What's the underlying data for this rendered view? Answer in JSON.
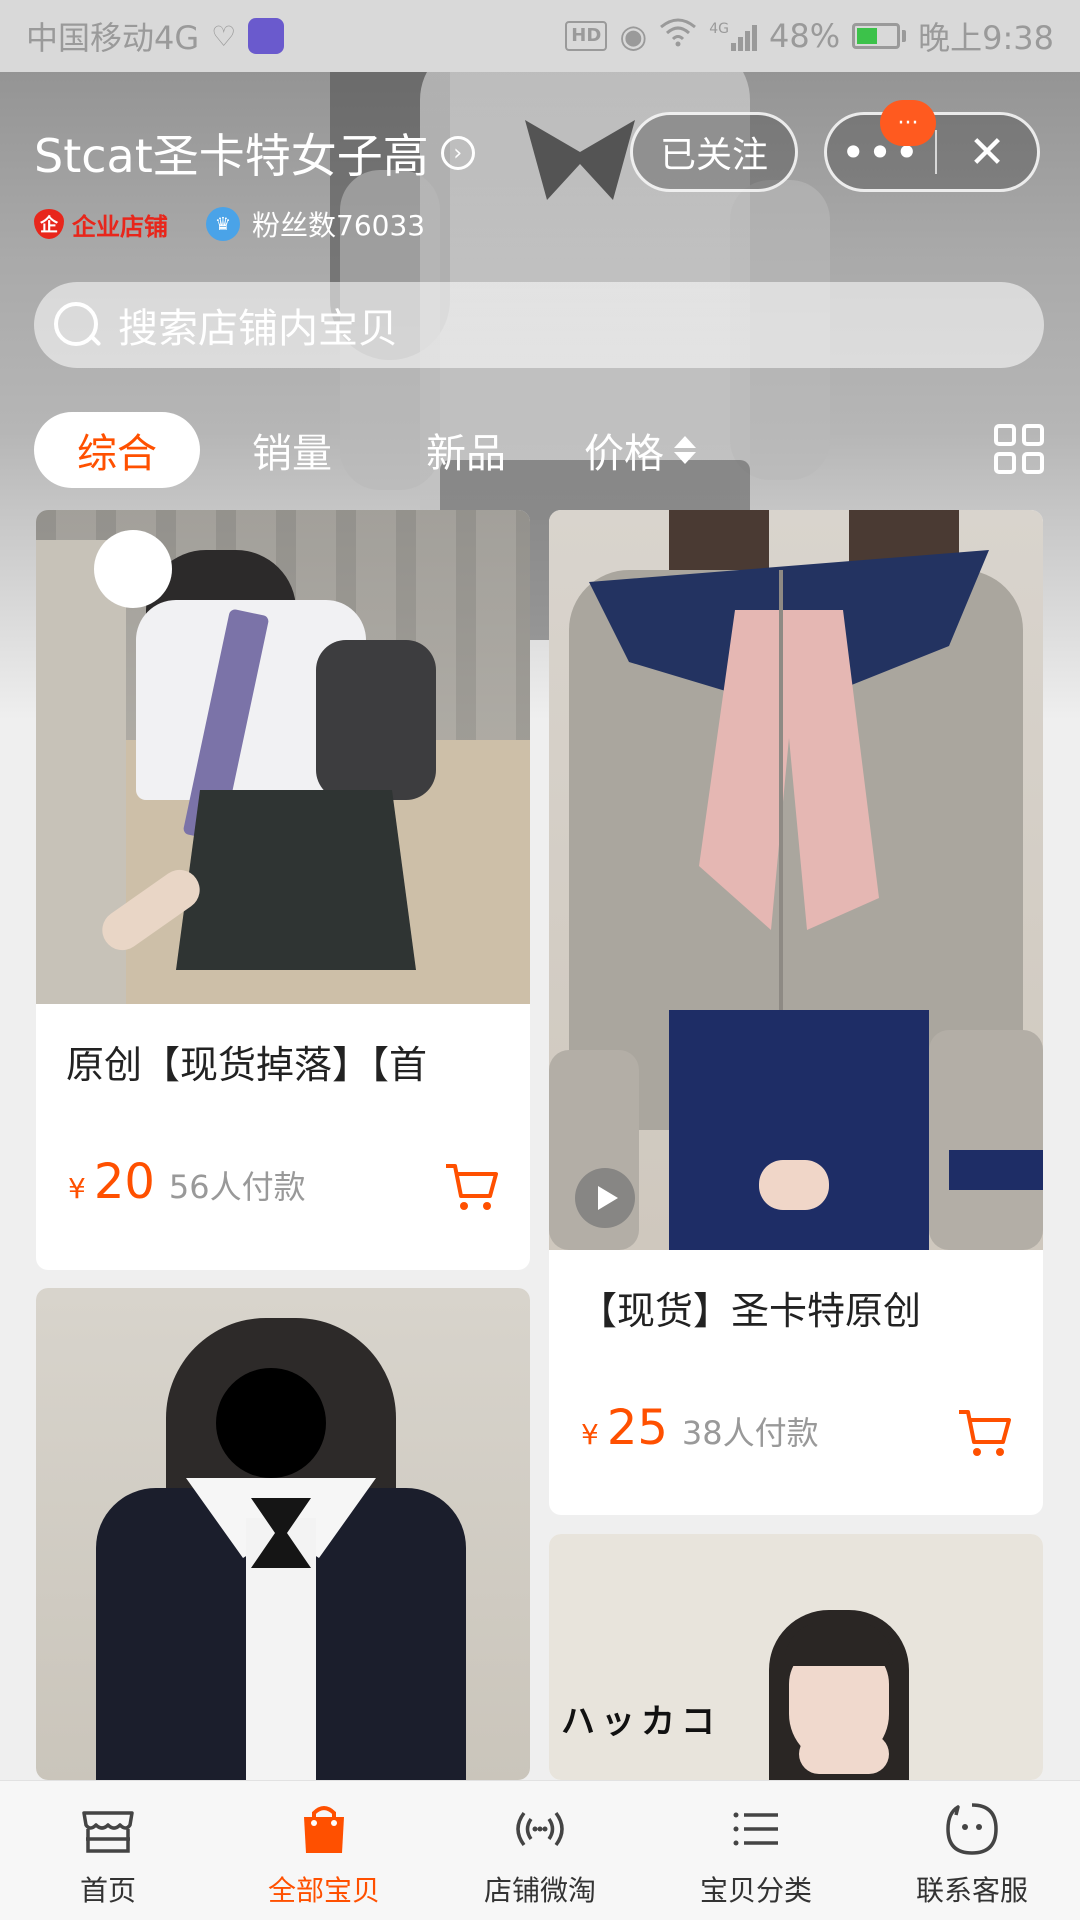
{
  "status_bar": {
    "carrier": "中国移动4G",
    "hd": "HD",
    "signal": "4G",
    "battery": "48%",
    "time": "晚上9:38"
  },
  "shop": {
    "name": "Stcat圣卡特女子高",
    "follow_label": "已关注",
    "message_badge": "···",
    "enterprise_label": "企业店铺",
    "fans_label": "粉丝数76033"
  },
  "search": {
    "placeholder": "搜索店铺内宝贝"
  },
  "sort_tabs": [
    {
      "label": "综合",
      "active": true
    },
    {
      "label": "销量",
      "active": false
    },
    {
      "label": "新品",
      "active": false
    },
    {
      "label": "价格",
      "active": false
    }
  ],
  "products": [
    {
      "title": "原创【现货掉落】【首",
      "currency": "¥",
      "price": "20",
      "sold": "56人付款"
    },
    {
      "title": "【现货】圣卡特原创",
      "currency": "¥",
      "price": "25",
      "sold": "38人付款",
      "has_video": true
    },
    {
      "title": "",
      "currency": "",
      "price": "",
      "sold": ""
    },
    {
      "title": "",
      "currency": "",
      "price": "",
      "sold": "",
      "image_text": "ハッカコ"
    }
  ],
  "tab_bar": [
    {
      "label": "首页",
      "icon": "store-icon",
      "active": false
    },
    {
      "label": "全部宝贝",
      "icon": "bag-icon",
      "active": true
    },
    {
      "label": "店铺微淘",
      "icon": "broadcast-icon",
      "active": false
    },
    {
      "label": "宝贝分类",
      "icon": "list-icon",
      "active": false
    },
    {
      "label": "联系客服",
      "icon": "chat-face-icon",
      "active": false
    }
  ],
  "colors": {
    "accent": "#ff5000",
    "enterprise_red": "#e8261b",
    "text_muted": "#999999"
  }
}
